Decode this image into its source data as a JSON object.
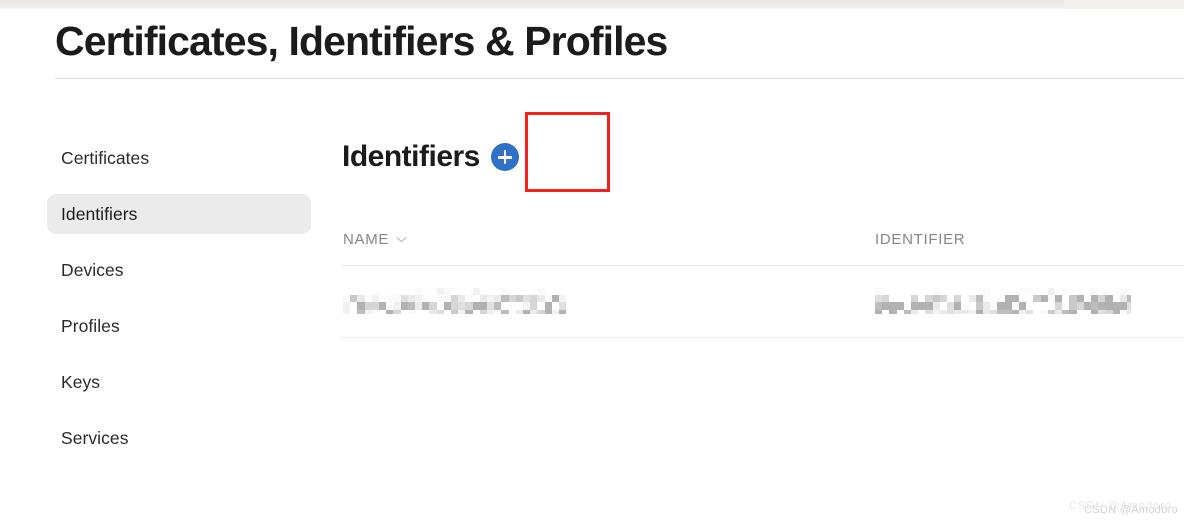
{
  "page": {
    "title": "Certificates, Identifiers & Profiles"
  },
  "sidebar": {
    "items": [
      {
        "label": "Certificates",
        "selected": false
      },
      {
        "label": "Identifiers",
        "selected": true
      },
      {
        "label": "Devices",
        "selected": false
      },
      {
        "label": "Profiles",
        "selected": false
      },
      {
        "label": "Keys",
        "selected": false
      },
      {
        "label": "Services",
        "selected": false
      }
    ]
  },
  "main": {
    "section_title": "Identifiers",
    "add_button": {
      "icon": "plus-icon",
      "label": "+",
      "color": "#3071c8"
    },
    "annotation": {
      "shape": "rectangle",
      "color": "#f42020"
    },
    "table": {
      "columns": [
        {
          "label": "NAME",
          "sort_icon": "chevron-down-icon"
        },
        {
          "label": "IDENTIFIER",
          "sort_icon": ""
        }
      ],
      "rows": [
        {
          "name": "",
          "identifier": "",
          "redacted": true
        }
      ]
    }
  },
  "watermark": {
    "text": "CSDN @Amodoro",
    "ghost_text": "CSDN @Amodoro"
  }
}
